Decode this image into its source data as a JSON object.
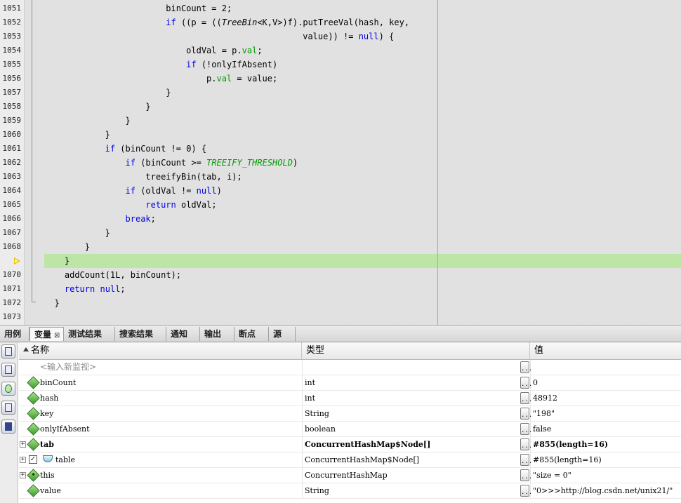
{
  "editor": {
    "current_line_number": "1069",
    "lines": [
      {
        "num": "1051",
        "indent": 24,
        "tokens": [
          {
            "t": "binCount = 2;",
            "c": "plain"
          }
        ]
      },
      {
        "num": "1052",
        "indent": 24,
        "tokens": [
          {
            "t": "if",
            "c": "kw"
          },
          {
            "t": " ((p = ((",
            "c": "plain"
          },
          {
            "t": "TreeBin",
            "c": "type"
          },
          {
            "t": "<K,V>)f).putTreeVal(hash, key,",
            "c": "plain"
          }
        ]
      },
      {
        "num": "1053",
        "indent": 51,
        "tokens": [
          {
            "t": "value)) != ",
            "c": "plain"
          },
          {
            "t": "null",
            "c": "kw"
          },
          {
            "t": ") {",
            "c": "plain"
          }
        ]
      },
      {
        "num": "1054",
        "indent": 28,
        "tokens": [
          {
            "t": "oldVal = p.",
            "c": "plain"
          },
          {
            "t": "val",
            "c": "fld"
          },
          {
            "t": ";",
            "c": "plain"
          }
        ]
      },
      {
        "num": "1055",
        "indent": 28,
        "tokens": [
          {
            "t": "if",
            "c": "kw"
          },
          {
            "t": " (!onlyIfAbsent)",
            "c": "plain"
          }
        ]
      },
      {
        "num": "1056",
        "indent": 32,
        "tokens": [
          {
            "t": "p.",
            "c": "plain"
          },
          {
            "t": "val",
            "c": "fld"
          },
          {
            "t": " = value;",
            "c": "plain"
          }
        ]
      },
      {
        "num": "1057",
        "indent": 24,
        "tokens": [
          {
            "t": "}",
            "c": "plain"
          }
        ]
      },
      {
        "num": "1058",
        "indent": 20,
        "tokens": [
          {
            "t": "}",
            "c": "plain"
          }
        ]
      },
      {
        "num": "1059",
        "indent": 16,
        "tokens": [
          {
            "t": "}",
            "c": "plain"
          }
        ]
      },
      {
        "num": "1060",
        "indent": 12,
        "tokens": [
          {
            "t": "}",
            "c": "plain"
          }
        ]
      },
      {
        "num": "1061",
        "indent": 12,
        "tokens": [
          {
            "t": "if",
            "c": "kw"
          },
          {
            "t": " (binCount != 0) {",
            "c": "plain"
          }
        ]
      },
      {
        "num": "1062",
        "indent": 16,
        "tokens": [
          {
            "t": "if",
            "c": "kw"
          },
          {
            "t": " (binCount >= ",
            "c": "plain"
          },
          {
            "t": "TREEIFY_THRESHOLD",
            "c": "const"
          },
          {
            "t": ")",
            "c": "plain"
          }
        ]
      },
      {
        "num": "1063",
        "indent": 20,
        "tokens": [
          {
            "t": "treeifyBin(tab, i);",
            "c": "plain"
          }
        ]
      },
      {
        "num": "1064",
        "indent": 16,
        "tokens": [
          {
            "t": "if",
            "c": "kw"
          },
          {
            "t": " (oldVal != ",
            "c": "plain"
          },
          {
            "t": "null",
            "c": "kw"
          },
          {
            "t": ")",
            "c": "plain"
          }
        ]
      },
      {
        "num": "1065",
        "indent": 20,
        "tokens": [
          {
            "t": "return",
            "c": "kw"
          },
          {
            "t": " oldVal;",
            "c": "plain"
          }
        ]
      },
      {
        "num": "1066",
        "indent": 16,
        "tokens": [
          {
            "t": "break",
            "c": "kw"
          },
          {
            "t": ";",
            "c": "plain"
          }
        ]
      },
      {
        "num": "1067",
        "indent": 12,
        "tokens": [
          {
            "t": "}",
            "c": "plain"
          }
        ]
      },
      {
        "num": "1068",
        "indent": 8,
        "tokens": [
          {
            "t": "}",
            "c": "plain"
          }
        ]
      },
      {
        "num": "1069",
        "indent": 4,
        "tokens": [
          {
            "t": "}",
            "c": "plain"
          }
        ]
      },
      {
        "num": "1070",
        "indent": 4,
        "tokens": [
          {
            "t": "addCount(1L, binCount);",
            "c": "plain"
          }
        ]
      },
      {
        "num": "1071",
        "indent": 4,
        "tokens": [
          {
            "t": "return",
            "c": "kw"
          },
          {
            "t": " ",
            "c": "plain"
          },
          {
            "t": "null",
            "c": "kw"
          },
          {
            "t": ";",
            "c": "plain"
          }
        ]
      },
      {
        "num": "1072",
        "indent": 2,
        "tokens": [
          {
            "t": "}",
            "c": "plain"
          }
        ]
      },
      {
        "num": "1073",
        "indent": 0,
        "tokens": []
      }
    ]
  },
  "tabs": [
    {
      "label": "用例",
      "active": false
    },
    {
      "label": "变量",
      "active": true,
      "closable": true
    },
    {
      "label": "测试结果",
      "active": false
    },
    {
      "label": "搜索结果",
      "active": false
    },
    {
      "label": "通知",
      "active": false
    },
    {
      "label": "输出",
      "active": false
    },
    {
      "label": "断点",
      "active": false
    },
    {
      "label": "源",
      "active": false
    }
  ],
  "tab_close_glyph": "⊠",
  "variables": {
    "columns": {
      "name": "名称",
      "type": "类型",
      "value": "值"
    },
    "placeholder": "<输入新监视>",
    "ellipsis": "...",
    "rows": [
      {
        "name": "binCount",
        "type": "int",
        "value": "0",
        "icon": "variable-icon"
      },
      {
        "name": "hash",
        "type": "int",
        "value": "48912",
        "icon": "variable-icon"
      },
      {
        "name": "key",
        "type": "String",
        "value": "\"198\"",
        "icon": "variable-icon"
      },
      {
        "name": "onlyIfAbsent",
        "type": "boolean",
        "value": "false",
        "icon": "variable-icon"
      },
      {
        "name": "tab",
        "type": "ConcurrentHashMap$Node[]",
        "value": "#855(length=16)",
        "icon": "variable-icon",
        "expandable": true,
        "bold": true
      },
      {
        "name": "table",
        "type": "ConcurrentHashMap$Node[]",
        "value": "#855(length=16)",
        "icon": "field-icon",
        "expandable": true,
        "checkbox": true
      },
      {
        "name": "this",
        "type": "ConcurrentHashMap",
        "value": "\"size = 0\"",
        "icon": "this-icon",
        "expandable": true
      },
      {
        "name": "value",
        "type": "String",
        "value": "\"0>>>http://blog.csdn.net/unix21/\"",
        "icon": "variable-icon"
      }
    ]
  }
}
